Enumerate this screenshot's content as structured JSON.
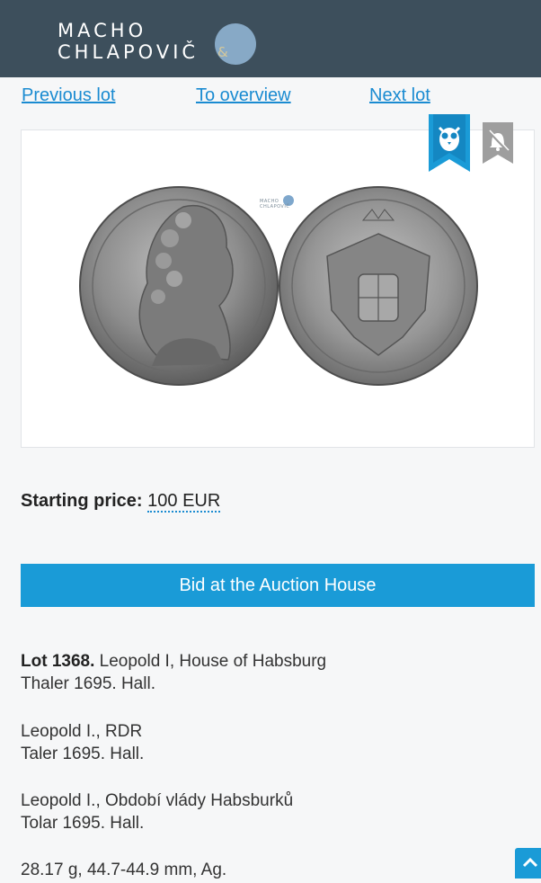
{
  "header": {
    "logo_line1": "MACHO",
    "logo_amp": "&",
    "logo_line2": "CHLAPOVIČ"
  },
  "nav": {
    "previous": "Previous lot",
    "overview": "To overview",
    "next": "Next lot"
  },
  "image": {
    "watermark_line1": "MACHO",
    "watermark_line2": "CHLAPOVIČ",
    "obverse_legend": "LEOPOLDUS·D·G·ROM·IMP·S·A·GE·HU·BO·REX",
    "reverse_legend": "16 95 ARCHIDUX·AUSTRI·DUX·BURG·COM·TYRO"
  },
  "icons": {
    "bookmark": "owl-bookmark-icon",
    "bell": "bell-off-icon",
    "top": "chevron-up-icon"
  },
  "price": {
    "label": "Starting price:",
    "value": "100 EUR"
  },
  "bid_button": "Bid at the Auction House",
  "description": {
    "lot_label": "Lot 1368.",
    "en_title": "Leopold I, House of Habsburg",
    "en_subtitle": "Thaler 1695. Hall.",
    "de_title": "Leopold I., RDR",
    "de_subtitle": "Taler 1695. Hall.",
    "cz_title": "Leopold I., Období vlády Habsburků",
    "cz_subtitle": "Tolar 1695. Hall.",
    "specs": "28.17 g, 44.7-44.9 mm, Ag."
  },
  "colors": {
    "header_bg": "#3d4f5c",
    "accent": "#1a9bd7",
    "link": "#1a8bd1"
  }
}
